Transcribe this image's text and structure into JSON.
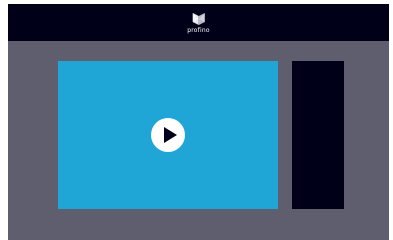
{
  "header": {
    "brand": "profino",
    "logo_icon": "profino-logo-icon"
  },
  "player": {
    "play_icon": "play-icon"
  },
  "colors": {
    "background": "#5f5e6e",
    "header": "#000019",
    "video": "#1fa6d6",
    "side_panel": "#000019",
    "play_button": "#ffffff"
  }
}
